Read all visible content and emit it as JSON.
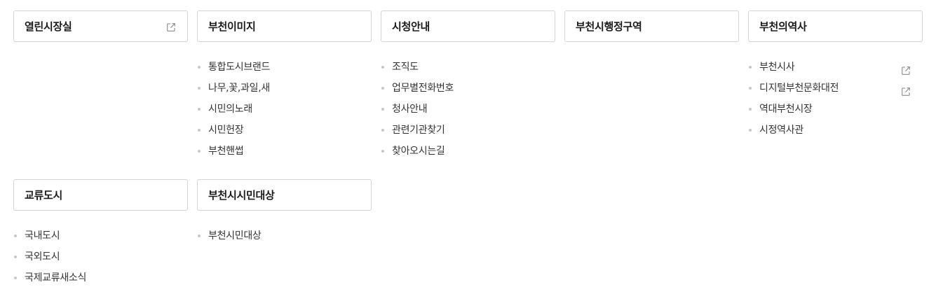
{
  "rows": [
    [
      {
        "title": "열린시장실",
        "external": true,
        "items": []
      },
      {
        "title": "부천이미지",
        "external": false,
        "items": [
          {
            "label": "통합도시브랜드",
            "external": false
          },
          {
            "label": "나무,꽃,과일,새",
            "external": false
          },
          {
            "label": "시민의노래",
            "external": false
          },
          {
            "label": "시민헌장",
            "external": false
          },
          {
            "label": "부천핸썹",
            "external": false
          }
        ]
      },
      {
        "title": "시청안내",
        "external": false,
        "items": [
          {
            "label": "조직도",
            "external": false
          },
          {
            "label": "업무별전화번호",
            "external": false
          },
          {
            "label": "청사안내",
            "external": false
          },
          {
            "label": "관련기관찾기",
            "external": false
          },
          {
            "label": "찾아오시는길",
            "external": false
          }
        ]
      },
      {
        "title": "부천시행정구역",
        "external": false,
        "items": []
      },
      {
        "title": "부천의역사",
        "external": false,
        "items": [
          {
            "label": "부천시사",
            "external": true
          },
          {
            "label": "디지털부천문화대전",
            "external": true
          },
          {
            "label": "역대부천시장",
            "external": false
          },
          {
            "label": "시정역사관",
            "external": false
          }
        ]
      }
    ],
    [
      {
        "title": "교류도시",
        "external": false,
        "items": [
          {
            "label": "국내도시",
            "external": false
          },
          {
            "label": "국외도시",
            "external": false
          },
          {
            "label": "국제교류새소식",
            "external": false
          }
        ]
      },
      {
        "title": "부천시시민대상",
        "external": false,
        "items": [
          {
            "label": "부천시민대상",
            "external": false
          }
        ]
      }
    ]
  ],
  "icons": {
    "external_link": "external-link-icon"
  },
  "colors": {
    "border": "#d4d4d4",
    "bullet": "#c8c8c8",
    "icon": "#8a8a8a",
    "text": "#333333"
  }
}
